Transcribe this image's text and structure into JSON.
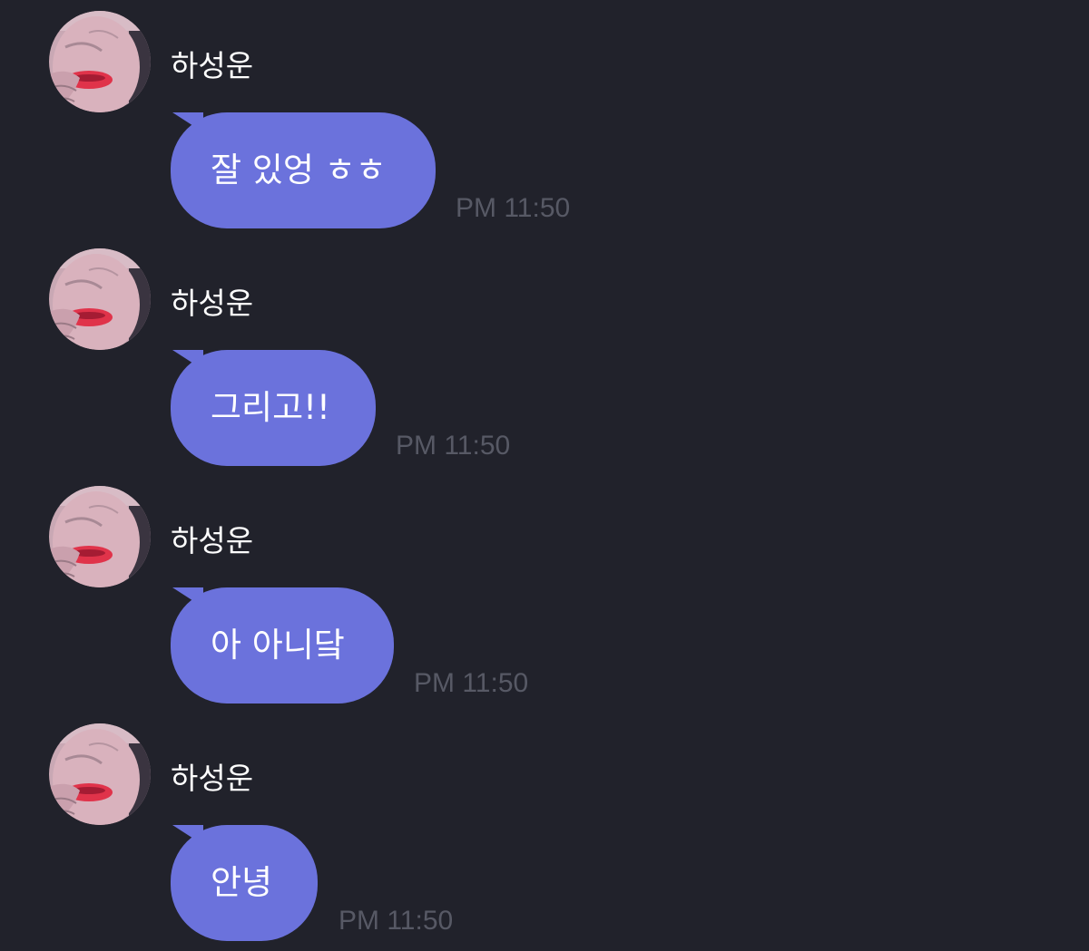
{
  "messages": [
    {
      "sender": "하성운",
      "text": "잘 있엉 ㅎㅎ",
      "time": "PM 11:50"
    },
    {
      "sender": "하성운",
      "text": "그리고!!",
      "time": "PM 11:50"
    },
    {
      "sender": "하성운",
      "text": "아 아니닼",
      "time": "PM 11:50"
    },
    {
      "sender": "하성운",
      "text": "안녕",
      "time": "PM 11:50"
    }
  ],
  "colors": {
    "background": "#21222b",
    "bubble": "#6b72dc",
    "time_text": "#575965",
    "name_text": "#ffffff"
  }
}
